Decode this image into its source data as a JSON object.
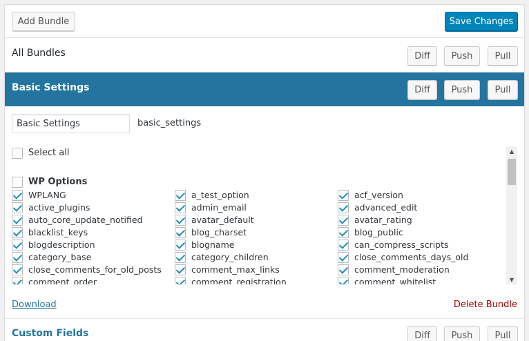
{
  "toolbar": {
    "add_bundle": "Add Bundle",
    "save_changes": "Save Changes"
  },
  "all_bundles": {
    "title": "All Bundles",
    "diff": "Diff",
    "push": "Push",
    "pull": "Pull"
  },
  "basic_settings": {
    "title": "Basic Settings",
    "diff": "Diff",
    "push": "Push",
    "pull": "Pull",
    "name_value": "Basic Settings",
    "slug": "basic_settings",
    "select_all": "Select all",
    "group_title": "WP Options",
    "options": [
      [
        "WPLANG",
        "a_test_option",
        "acf_version"
      ],
      [
        "active_plugins",
        "admin_email",
        "advanced_edit"
      ],
      [
        "auto_core_update_notified",
        "avatar_default",
        "avatar_rating"
      ],
      [
        "blacklist_keys",
        "blog_charset",
        "blog_public"
      ],
      [
        "blogdescription",
        "blogname",
        "can_compress_scripts"
      ],
      [
        "category_base",
        "category_children",
        "close_comments_days_old"
      ],
      [
        "close_comments_for_old_posts",
        "comment_max_links",
        "comment_moderation"
      ],
      [
        "comment_order",
        "comment_registration",
        "comment_whitelist"
      ]
    ],
    "download": "Download",
    "delete_bundle": "Delete Bundle"
  },
  "custom_fields": {
    "title": "Custom Fields",
    "diff": "Diff",
    "push": "Push",
    "pull": "Pull"
  },
  "colors": {
    "accent": "#23759f",
    "primary_button": "#0085ba",
    "delete": "#aa0000",
    "check": "#1e8cbe"
  }
}
